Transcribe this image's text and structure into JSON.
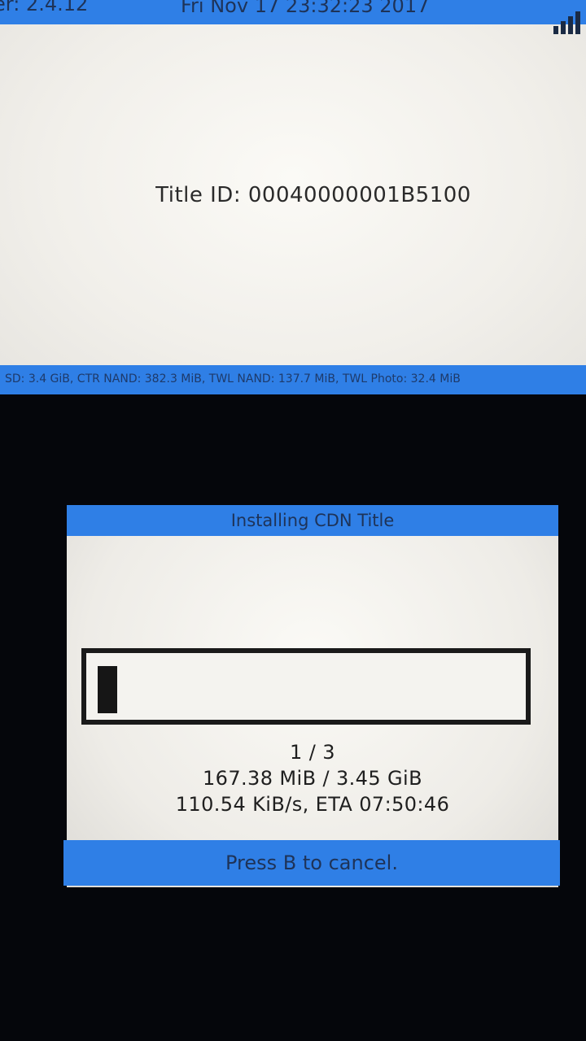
{
  "top_screen": {
    "version": "er: 2.4.12",
    "clock": "Fri Nov 17 23:32:23 2017",
    "title_id": "Title ID: 00040000001B5100",
    "storage": "SD: 3.4 GiB, CTR NAND: 382.3 MiB, TWL NAND: 137.7 MiB, TWL Photo: 32.4 MiB"
  },
  "dialog": {
    "title": "Installing CDN Title",
    "progress": 0.04,
    "count": "1 / 3",
    "size": "167.38 MiB / 3.45 GiB",
    "speed": "110.54 KiB/s, ETA 07:50:46",
    "cancel_hint": "Press B to cancel."
  },
  "colors": {
    "bar_blue": "#2f7fe6",
    "panel": "#f0efea",
    "background": "#05060b"
  }
}
